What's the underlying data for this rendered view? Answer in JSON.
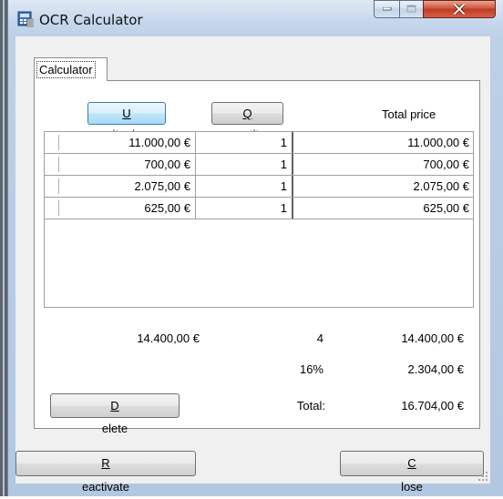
{
  "window": {
    "title": "OCR Calculator"
  },
  "tab": {
    "label": "Calculator"
  },
  "headers": {
    "unit_price": {
      "label": "Unit price",
      "mnemonic": "U",
      "rest": "nit price"
    },
    "quantity": {
      "label": "Quantity",
      "mnemonic": "Q",
      "rest": "uantity"
    },
    "total_price": "Total price"
  },
  "rows": [
    {
      "unit_price": "11.000,00 €",
      "quantity": "1",
      "total_price": "11.000,00 €"
    },
    {
      "unit_price": "700,00 €",
      "quantity": "1",
      "total_price": "700,00 €"
    },
    {
      "unit_price": "2.075,00 €",
      "quantity": "1",
      "total_price": "2.075,00 €"
    },
    {
      "unit_price": "625,00 €",
      "quantity": "1",
      "total_price": "625,00 €"
    }
  ],
  "summary": {
    "unit_sum": "14.400,00 €",
    "quantity_sum": "4",
    "net_total": "14.400,00 €",
    "tax_rate": "16%",
    "tax_amount": "2.304,00 €",
    "total_label": "Total:",
    "grand_total": "16.704,00 €"
  },
  "buttons": {
    "delete": {
      "label": "Delete",
      "mnemonic": "D",
      "rest": "elete"
    },
    "reactivate": {
      "label": "Reactivate",
      "mnemonic": "R",
      "rest": "eactivate"
    },
    "close": {
      "label": "Close",
      "mnemonic": "C",
      "rest": "lose"
    }
  },
  "icons": {
    "app": "calculator-icon",
    "minimize": "minimize-icon",
    "maximize": "maximize-icon",
    "close": "close-icon",
    "grip": "resize-grip-icon"
  },
  "colors": {
    "active_button": "#bee6fd",
    "close_button": "#c03a21",
    "title_bar": "#c6d7ec"
  }
}
